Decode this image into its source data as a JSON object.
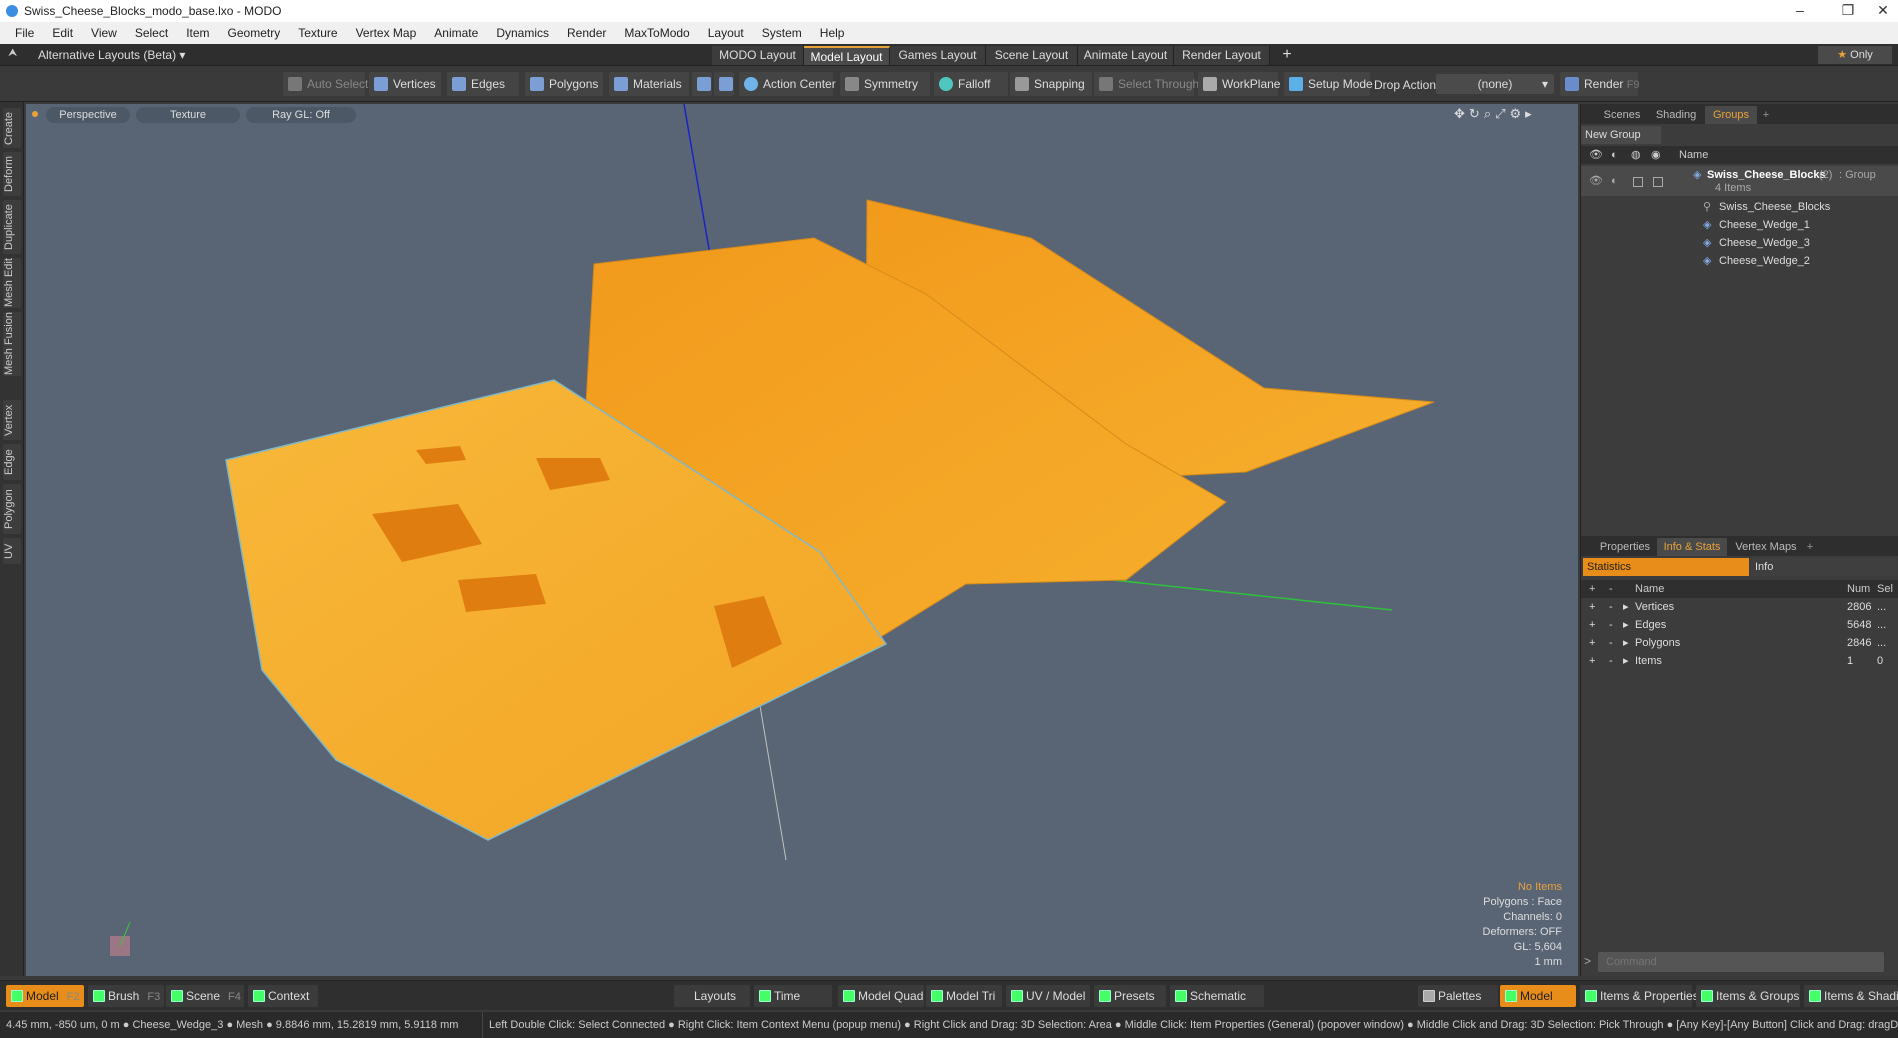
{
  "window": {
    "title": "Swiss_Cheese_Blocks_modo_base.lxo - MODO"
  },
  "menu": [
    "File",
    "Edit",
    "View",
    "Select",
    "Item",
    "Geometry",
    "Texture",
    "Vertex Map",
    "Animate",
    "Dynamics",
    "Render",
    "MaxToModo",
    "Layout",
    "System",
    "Help"
  ],
  "layoutbar": {
    "alt_layouts": "Alternative Layouts (Beta)",
    "tabs": [
      "MODO Layout",
      "Model Layout",
      "Games Layout",
      "Scene Layout",
      "Animate Layout",
      "Render Layout"
    ],
    "active_tab": "Model Layout",
    "add": "+",
    "only": "Only"
  },
  "toolbar": {
    "auto_select": "Auto Select",
    "vertices": "Vertices",
    "edges": "Edges",
    "polygons": "Polygons",
    "materials": "Materials",
    "action_center": "Action Center",
    "symmetry": "Symmetry",
    "falloff": "Falloff",
    "snapping": "Snapping",
    "select_through": "Select Through",
    "workplane": "WorkPlane",
    "setup_mode": "Setup Mode",
    "drop_action": "Drop Action",
    "drop_value": "(none)",
    "render": "Render",
    "render_key": "F9"
  },
  "left_tabs": [
    "Create",
    "Deform",
    "Duplicate",
    "Mesh Edit",
    "Mesh Fusion",
    "Vertex",
    "Edge",
    "Polygon",
    "UV"
  ],
  "viewport": {
    "perspective": "Perspective",
    "texture": "Texture",
    "raygl": "Ray GL: Off",
    "hud": {
      "no_items": "No Items",
      "polygons": "Polygons : Face",
      "channels": "Channels: 0",
      "deformers": "Deformers: OFF",
      "gl": "GL: 5,604",
      "unit": "1 mm"
    }
  },
  "scene_panel": {
    "tabs": [
      "Scenes",
      "Shading",
      "Groups"
    ],
    "active_tab": "Groups",
    "new_group": "New Group",
    "col_name": "Name",
    "group": {
      "name": "Swiss_Cheese_Blocks",
      "count": "(2)",
      "type": ": Group",
      "items": "4 Items"
    },
    "children": [
      "Swiss_Cheese_Blocks",
      "Cheese_Wedge_1",
      "Cheese_Wedge_3",
      "Cheese_Wedge_2"
    ]
  },
  "props_panel": {
    "tabs": [
      "Properties",
      "Info & Stats",
      "Vertex Maps"
    ],
    "active_tab": "Info & Stats",
    "subtabs": [
      "Statistics",
      "Info"
    ],
    "headers": {
      "name": "Name",
      "num": "Num",
      "sel": "Sel"
    },
    "rows": [
      {
        "name": "Vertices",
        "num": "2806",
        "sel": "..."
      },
      {
        "name": "Edges",
        "num": "5648",
        "sel": "..."
      },
      {
        "name": "Polygons",
        "num": "2846",
        "sel": "..."
      },
      {
        "name": "Items",
        "num": "1",
        "sel": "0"
      }
    ]
  },
  "command": {
    "placeholder": "Command"
  },
  "bottombar": {
    "model": "Model",
    "model_key": "F2",
    "brush": "Brush",
    "brush_key": "F3",
    "scene": "Scene",
    "scene_key": "F4",
    "context": "Context",
    "layouts": "Layouts",
    "time": "Time",
    "model_quad": "Model Quad",
    "model_tri": "Model Tri",
    "uv_model": "UV / Model",
    "presets": "Presets",
    "schematic": "Schematic",
    "palettes": "Palettes",
    "model2": "Model",
    "items_props": "Items & Properties",
    "items_groups": "Items & Groups",
    "items_shading": "Items & Shadin"
  },
  "statusbar": {
    "text": "4.45 mm, -850 um, 0 m ● Cheese_Wedge_3 ● Mesh ● 9.8846 mm, 15.2819 mm, 5.9118 mm",
    "hints": "Left Double Click: Select Connected ● Right Click: Item Context Menu (popup menu) ● Right Click and Drag: 3D Selection: Area ● Middle Click: Item Properties (General) (popover window) ● Middle Click and Drag: 3D Selection: Pick Through ● [Any Key]-[Any Button] Click and Drag: dragDrop"
  }
}
